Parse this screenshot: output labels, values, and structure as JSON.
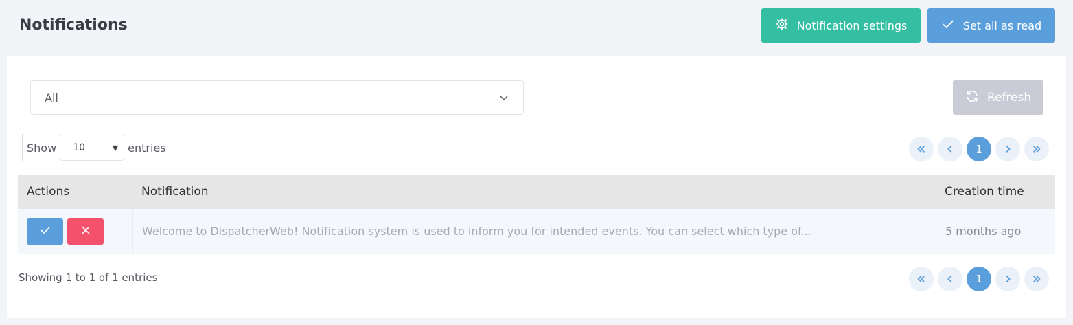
{
  "header": {
    "title": "Notifications",
    "settings_label": "Notification settings",
    "read_all_label": "Set all as read"
  },
  "filter": {
    "selected": "All",
    "refresh_label": "Refresh"
  },
  "length": {
    "show_label": "Show",
    "value": "10",
    "entries_label": "entries"
  },
  "pagination": {
    "current_page": "1"
  },
  "table": {
    "columns": [
      "Actions",
      "Notification",
      "Creation time"
    ],
    "rows": [
      {
        "notification": "Welcome to DispatcherWeb! Notification system is used to inform you for intended events. You can select which type of...",
        "time": "5 months ago"
      }
    ]
  },
  "info_text": "Showing 1 to 1 of 1 entries",
  "colors": {
    "accent_green": "#34bfa3",
    "accent_blue": "#5a9fdc",
    "danger": "#f4516c",
    "disabled": "#c9cbd6"
  }
}
